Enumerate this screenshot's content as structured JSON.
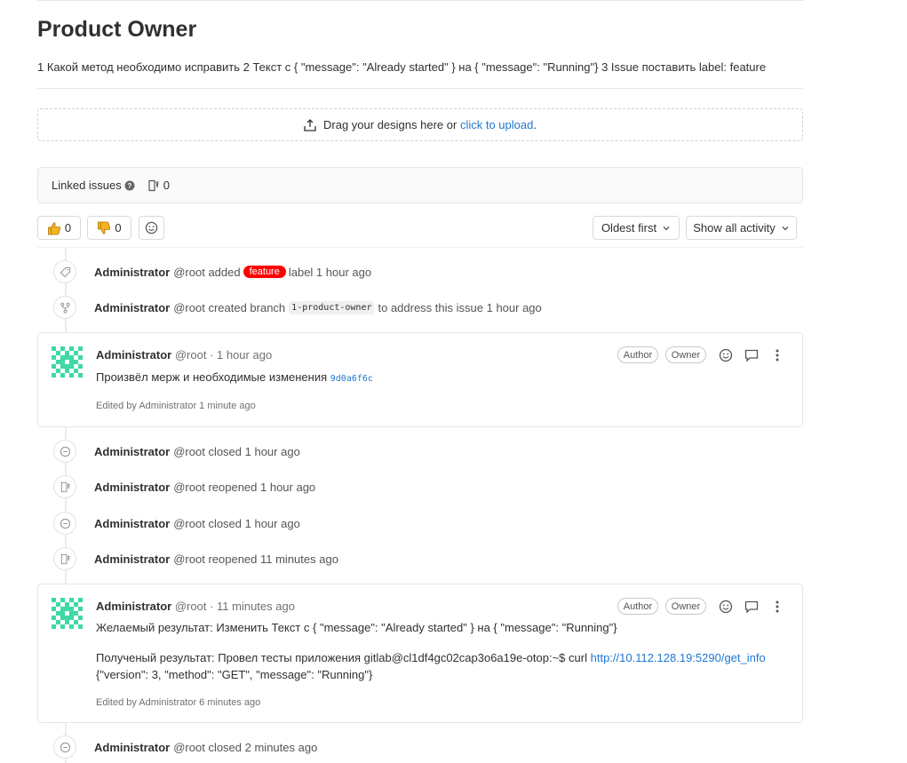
{
  "issue": {
    "title": "Product Owner",
    "description": "1 Какой метод необходимо исправить 2 Текст с { \"message\": \"Already started\" } на { \"message\": \"Running\"} 3 Issue поставить label: feature"
  },
  "dropzone": {
    "text": "Drag your designs here or",
    "link": "click to upload",
    "suffix": "."
  },
  "linked_issues": {
    "label": "Linked issues",
    "count": "0"
  },
  "awards": {
    "thumbs_up": "0",
    "thumbs_down": "0"
  },
  "sort": {
    "order": "Oldest first",
    "filter": "Show all activity"
  },
  "timeline": {
    "e1": {
      "author": "Administrator",
      "text1": "@root added",
      "label": "feature",
      "text2": "label 1 hour ago",
      "icon": "tag-icon"
    },
    "e2": {
      "author": "Administrator",
      "text1": "@root created branch",
      "branch": "1-product-owner",
      "text2": "to address this issue 1 hour ago",
      "icon": "fork-icon"
    },
    "note1": {
      "author": "Administrator",
      "meta": "@root · 1 hour ago",
      "role1": "Author",
      "role2": "Owner",
      "body": "Произвёл мерж и необходимые изменения",
      "sha": "9d0a6f6c",
      "edited": "Edited by Administrator 1 minute ago"
    },
    "e3": {
      "author": "Administrator",
      "text": "@root closed 1 hour ago",
      "icon": "closed-icon"
    },
    "e4": {
      "author": "Administrator",
      "text": "@root reopened 1 hour ago",
      "icon": "reopened-icon"
    },
    "e5": {
      "author": "Administrator",
      "text": "@root closed 1 hour ago",
      "icon": "closed-icon"
    },
    "e6": {
      "author": "Administrator",
      "text": "@root reopened 11 minutes ago",
      "icon": "reopened-icon"
    },
    "note2": {
      "author": "Administrator",
      "meta": "@root · 11 minutes ago",
      "role1": "Author",
      "role2": "Owner",
      "line1": "Желаемый результат: Изменить Текст с { \"message\": \"Already started\" } на { \"message\": \"Running\"}",
      "line2": "Полученый результат: Провел тесты приложения gitlab@cl1df4gc02cap3o6a19e-otop:~$ curl",
      "url": "http://10.112.128.19:5290/get_info",
      "line3": "{\"version\": 3, \"method\": \"GET\", \"message\": \"Running\"}",
      "edited": "Edited by Administrator 6 minutes ago"
    },
    "e7": {
      "author": "Administrator",
      "text": "@root closed 2 minutes ago",
      "icon": "closed-icon"
    }
  },
  "colors": {
    "label_feature": "#ff0000",
    "link": "#1f78d1",
    "avatar": "#3fd8a6"
  }
}
